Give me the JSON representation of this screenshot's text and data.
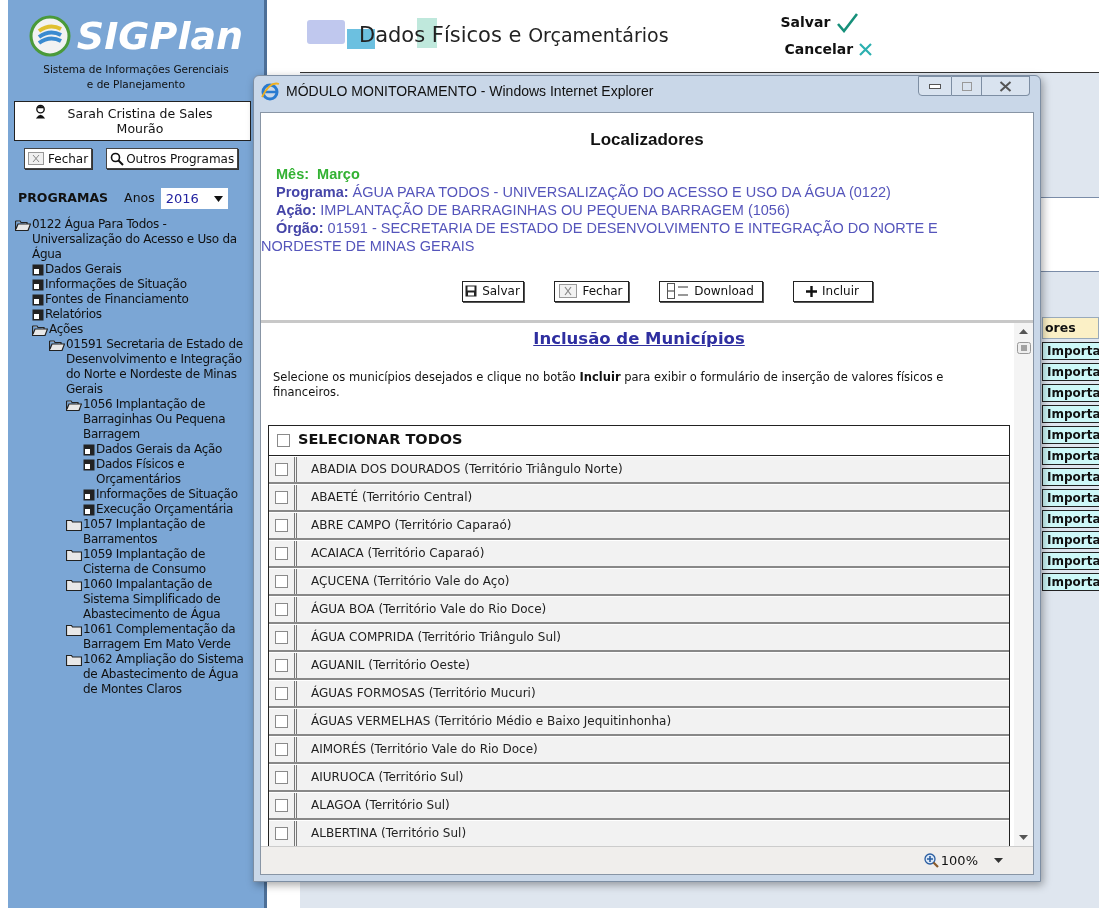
{
  "sidebar": {
    "logo": "SIGPlan",
    "subtitle": "Sistema de Informações Gerenciais e de Planejamento",
    "user": "Sarah Cristina de Sales Mourão",
    "buttons": [
      "Fechar",
      "Outros Programas"
    ],
    "programs_label": "PROGRAMAS",
    "year_label": "Anos",
    "year": "2016",
    "tree": [
      {
        "kind": "folder",
        "expanded": true,
        "label": "0122 Água Para Todos - Universalização do Acesso e Uso da Água",
        "children": [
          {
            "kind": "page",
            "label": "Dados Gerais"
          },
          {
            "kind": "page",
            "label": "Informações de Situação"
          },
          {
            "kind": "page",
            "label": "Fontes de Financiamento"
          },
          {
            "kind": "page",
            "label": "Relatórios"
          },
          {
            "kind": "folder",
            "expanded": true,
            "label": "Ações",
            "children": [
              {
                "kind": "folder",
                "expanded": true,
                "label": "01591 Secretaria de Estado de Desenvolvimento e Integração do Norte e Nordeste de Minas Gerais",
                "children": [
                  {
                    "kind": "folder",
                    "expanded": true,
                    "label": "1056 Implantação de Barraginhas Ou Pequena Barragem",
                    "children": [
                      {
                        "kind": "page",
                        "label": "Dados Gerais da Ação"
                      },
                      {
                        "kind": "page",
                        "label": "Dados Físicos e Orçamentários"
                      },
                      {
                        "kind": "page",
                        "label": "Informações de Situação"
                      },
                      {
                        "kind": "page",
                        "label": "Execução Orçamentária"
                      }
                    ]
                  },
                  {
                    "kind": "folder",
                    "expanded": false,
                    "label": "1057 Implantação de Barramentos"
                  },
                  {
                    "kind": "folder",
                    "expanded": false,
                    "label": "1059 Implantação de Cisterna de Consumo"
                  },
                  {
                    "kind": "folder",
                    "expanded": false,
                    "label": "1060 Impalantação de Sistema Simplificado de Abastecimento de Água"
                  },
                  {
                    "kind": "folder",
                    "expanded": false,
                    "label": "1061 Complementação da Barragem Em Mato Verde"
                  },
                  {
                    "kind": "folder",
                    "expanded": false,
                    "label": "1062 Ampliação do Sistema de Abastecimento de Água de Montes Claros"
                  }
                ]
              }
            ]
          }
        ]
      }
    ]
  },
  "page": {
    "title_part1": "Dados Físicos e",
    "title_part2": "Orçamentários",
    "save": "Salvar",
    "cancel": "Cancelar",
    "tab": "ores",
    "import_buttons": [
      "Importa",
      "Importa",
      "Importa",
      "Importa",
      "Importa",
      "Importa",
      "Importa",
      "Importa",
      "Importa",
      "Importa",
      "Importa",
      "Importa"
    ]
  },
  "popup": {
    "title": "MÓDULO MONITORAMENTO - Windows Internet Explorer",
    "heading": "Localizadores",
    "month_label": "Mês:",
    "month": "Março",
    "fields": [
      {
        "label": "Programa:",
        "value": "ÁGUA PARA TODOS - UNIVERSALIZAÇÃO DO ACESSO E USO DA ÁGUA (0122)"
      },
      {
        "label": "Ação:",
        "value": "IMPLANTAÇÃO DE BARRAGINHAS OU PEQUENA BARRAGEM (1056)"
      },
      {
        "label": "Órgão:",
        "value": "01591 - SECRETARIA DE ESTADO DE DESENVOLVIMENTO E INTEGRAÇÃO DO NORTE E NORDESTE DE MINAS GERAIS"
      }
    ],
    "buttons": [
      {
        "kind": "save",
        "label": "Salvar"
      },
      {
        "kind": "close",
        "label": "Fechar"
      },
      {
        "kind": "download",
        "label": "Download"
      },
      {
        "kind": "add",
        "label": "Incluir"
      }
    ],
    "section_title": "Inclusão de Municípios",
    "instructions": "Selecione os municípios desejados e clique no botão **Incluir** para exibir o formulário de inserção de valores físicos e financeiros.",
    "select_all": {
      "label": "SELECIONAR TODOS",
      "checked": false
    },
    "municipalities": [
      {
        "label": "ABADIA DOS DOURADOS (Território Triângulo Norte)",
        "checked": false
      },
      {
        "label": "ABAETÉ (Território Central)",
        "checked": false
      },
      {
        "label": "ABRE CAMPO (Território Caparaó)",
        "checked": false
      },
      {
        "label": "ACAIACA (Território Caparaó)",
        "checked": false
      },
      {
        "label": "AÇUCENA (Território Vale do Aço)",
        "checked": false
      },
      {
        "label": "ÁGUA BOA (Território Vale do Rio Doce)",
        "checked": false
      },
      {
        "label": "ÁGUA COMPRIDA (Território Triângulo Sul)",
        "checked": false
      },
      {
        "label": "AGUANIL (Território Oeste)",
        "checked": false
      },
      {
        "label": "ÁGUAS FORMOSAS (Território Mucuri)",
        "checked": false
      },
      {
        "label": "ÁGUAS VERMELHAS (Território Médio e Baixo Jequitinhonha)",
        "checked": false
      },
      {
        "label": "AIMORÉS (Território Vale do Rio Doce)",
        "checked": false
      },
      {
        "label": "AIURUOCA (Território Sul)",
        "checked": false
      },
      {
        "label": "ALAGOA (Território Sul)",
        "checked": false
      },
      {
        "label": "ALBERTINA (Território Sul)",
        "checked": false
      }
    ],
    "zoom": "100%"
  }
}
